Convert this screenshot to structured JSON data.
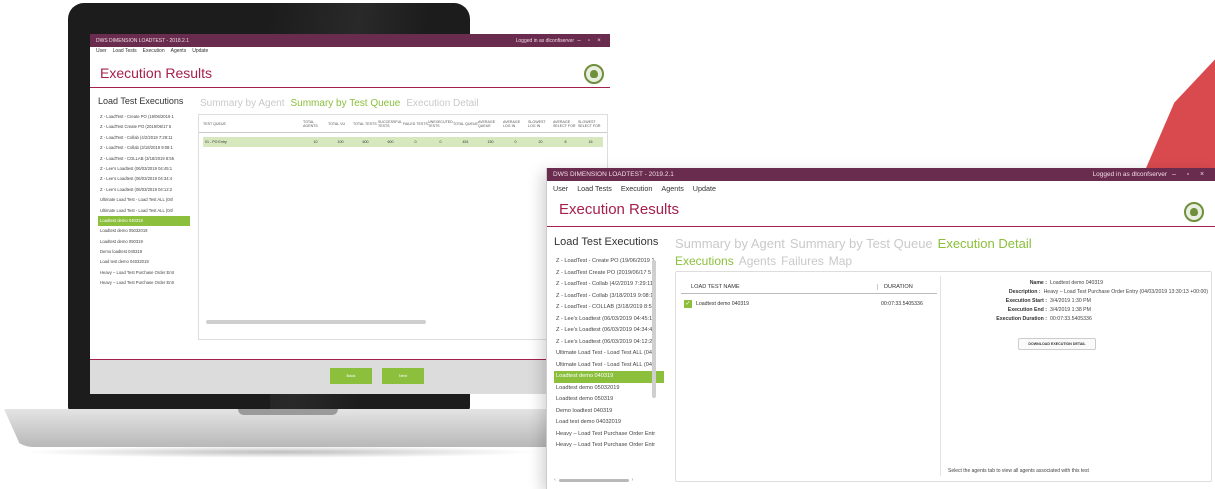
{
  "colors": {
    "titlebar": "#6a2c4e",
    "accent": "#a6204c",
    "green": "#8bbf3c",
    "tab_inactive": "#c9c9c9"
  },
  "small_app": {
    "title": "DWS DIMENSION LOADTEST - 2018.2.1",
    "user": "Logged in as dlconfiserver",
    "menu": [
      "User",
      "Load Tests",
      "Execution",
      "Agents",
      "Update"
    ],
    "heading": "Execution Results",
    "left_title": "Load Test Executions",
    "list": [
      "Z - LoadTest - Create PO (19/06/2019 1",
      "Z - LoadTest Create PO (2019/06/17 5",
      "Z - LoadTest - Collab (4/2/2019 7:29:11",
      "Z - LoadTest - Collab (3/18/2019 9:08:1",
      "Z - LoadTest - COLLAB (3/18/2019 8:55",
      "Z - Lee's Loadtest (06/03/2019 04:45:1",
      "Z - Lee's Loadtest (06/03/2019 04:34:4",
      "Z - Lee's Loadtest (06/03/2019 04:12:2",
      "Ultimate Load Test - Load Test ALL (04/",
      "Ultimate Load Test - Load Test ALL (04/",
      "Loadtest demo 040319",
      "Loadtest demo 05032019",
      "Loadtest demo 050319",
      "Demo loadtest 040319",
      "Load test demo 04032019",
      "Heavy – Load Test Purchase Order Entr",
      "Heavy – Load Test Purchase Order Entr"
    ],
    "selected_index": 10,
    "tabs": [
      "Summary by Agent",
      "Summary by Test Queue",
      "Execution Detail"
    ],
    "active_tab": 1,
    "table_headers": [
      "TEST QUEUE",
      "TOTAL AGENTS",
      "TOTAL VU",
      "TOTAL TESTS",
      "SUCCESSFUL TESTS",
      "FAILED TESTS",
      "UNEXECUTED TESTS",
      "TOTAL QUEUE",
      "AVERAGE QUEUE",
      "AVERAGE LOG IN",
      "SLOWEST LOG IN",
      "AVERAGE SELECT FOR",
      "SLOWEST SELECT FOR"
    ],
    "table_row": [
      "01 - PO Entry",
      "10",
      "100",
      "600",
      "600",
      "0",
      "0",
      "451",
      "150",
      "0",
      "20",
      "8",
      "16"
    ],
    "buttons": [
      "Back",
      "Next"
    ]
  },
  "big_app": {
    "title": "DWS DIMENSION LOADTEST - 2019.2.1",
    "user": "Logged in as dlconfserver",
    "menu": [
      "User",
      "Load Tests",
      "Execution",
      "Agents",
      "Update"
    ],
    "heading": "Execution Results",
    "left_title": "Load Test Executions",
    "list": [
      "Z - LoadTest - Create PO (19/06/2019 1",
      "Z - LoadTest Create PO (2019/06/17 5",
      "Z - LoadTest - Collab (4/2/2019 7:29:11",
      "Z - LoadTest - Collab (3/18/2019 9:08:1",
      "Z - LoadTest - COLLAB (3/18/2019 8:55",
      "Z - Lee's Loadtest (06/03/2019 04:45:1",
      "Z - Lee's Loadtest (06/03/2019 04:34:4",
      "Z - Lee's Loadtest (06/03/2019 04:12:2",
      "Ultimate Load Test - Load Test ALL (04/",
      "Ultimate Load Test - Load Test ALL (04/",
      "Loadtest demo 040319",
      "Loadtest demo 05032019",
      "Loadtest demo 050319",
      "Demo loadtest 040319",
      "Load test demo 04032019",
      "Heavy – Load Test Purchase Order Entr",
      "Heavy – Load Test Purchase Order Entr"
    ],
    "selected_index": 10,
    "tabs": [
      "Summary by Agent",
      "Summary by Test Queue",
      "Execution Detail"
    ],
    "active_tab": 2,
    "subtabs": [
      "Executions",
      "Agents",
      "Failures",
      "Map"
    ],
    "active_subtab": 0,
    "grid_headers": {
      "name": "LOAD TEST NAME",
      "duration": "DURATION"
    },
    "grid_row": {
      "name": "Loadtest demo 040319",
      "duration": "00:07:33.5405336"
    },
    "details": [
      {
        "key": "Name :",
        "value": "Loadtest demo 040319"
      },
      {
        "key": "Description :",
        "value": "Heavy – Load Test Purchase Order Entry (04/03/2019 13:30:13 +00:00)"
      },
      {
        "key": "Execution Start :",
        "value": "3/4/2019 1:30 PM"
      },
      {
        "key": "Execution End :",
        "value": "3/4/2019 1:38 PM"
      },
      {
        "key": "Execution Duration :",
        "value": "00:07:33.5405336"
      }
    ],
    "download_label": "DOWNLOAD EXECUTION DETAIL",
    "note": "Select the agents tab to view all agents associated with this test"
  }
}
